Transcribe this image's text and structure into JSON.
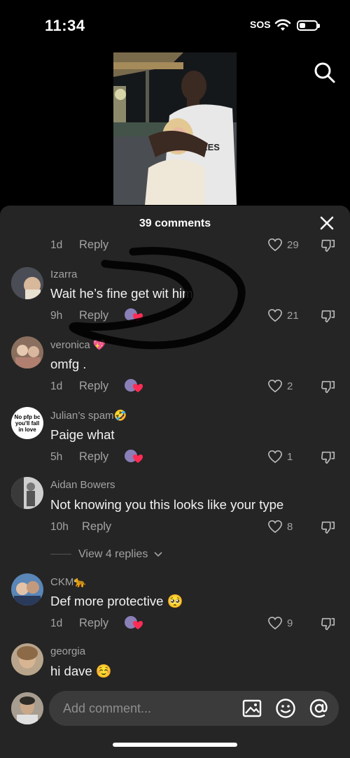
{
  "status": {
    "time": "11:34",
    "sos": "SOS",
    "battery_level": 0.35
  },
  "header_icons": [
    "search-icon"
  ],
  "sheet": {
    "title": "39 comments",
    "partial_row": {
      "time": "1d",
      "reply": "Reply",
      "likes": "29"
    }
  },
  "comments": [
    {
      "user": "Izarra",
      "text": "Wait he’s fine get wit him",
      "time": "9h",
      "reply": "Reply",
      "likes": "21",
      "creator_liked": true
    },
    {
      "user": "veronica 💖",
      "text": "omfg .",
      "time": "1d",
      "reply": "Reply",
      "likes": "2",
      "creator_liked": true
    },
    {
      "user": "Julian’s spam🤣",
      "text": "Paige what",
      "time": "5h",
      "reply": "Reply",
      "likes": "1",
      "creator_liked": true,
      "avatar_text": "No pfp bc you'll fall in love"
    },
    {
      "user": "Aidan Bowers",
      "text": "Not knowing you this looks like your type",
      "time": "10h",
      "reply": "Reply",
      "likes": "8",
      "creator_liked": false
    },
    {
      "user": "CKM🐆",
      "text": "Def more protective 🥺",
      "time": "1d",
      "reply": "Reply",
      "likes": "9",
      "creator_liked": true
    },
    {
      "user": "georgia",
      "text": "hi dave ☺️",
      "creator_liked": false
    }
  ],
  "view_replies": "View 4 replies",
  "input": {
    "placeholder": "Add comment...",
    "icons": [
      "image-icon",
      "emoji-icon",
      "mention-icon"
    ]
  },
  "colors": {
    "sheet_bg": "#252525",
    "muted_text": "#a3a3a3",
    "creator_heart": "#fe2c55"
  }
}
